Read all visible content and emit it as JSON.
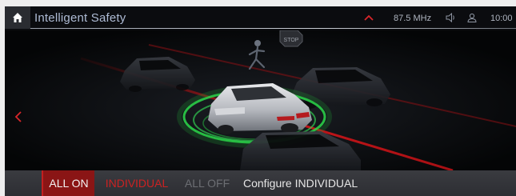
{
  "header": {
    "title": "Intelligent Safety",
    "radio_frequency": "87.5 MHz",
    "clock": "10:00",
    "icons": [
      "home-icon",
      "chevron-up-icon",
      "speaker-icon",
      "user-icon"
    ]
  },
  "scene": {
    "stop_sign_text": "STOP",
    "icons": [
      "back-arrow-icon",
      "pedestrian-icon"
    ]
  },
  "modes": {
    "all_on": "ALL ON",
    "individual": "INDIVIDUAL",
    "all_off": "ALL OFF",
    "configure": "Configure INDIVIDUAL",
    "active": "ALL ON"
  },
  "colors": {
    "accent_red": "#cc2222",
    "active_bg": "#8a1515",
    "sensor_green": "#2bd94a",
    "title_text": "#aebbd4"
  }
}
